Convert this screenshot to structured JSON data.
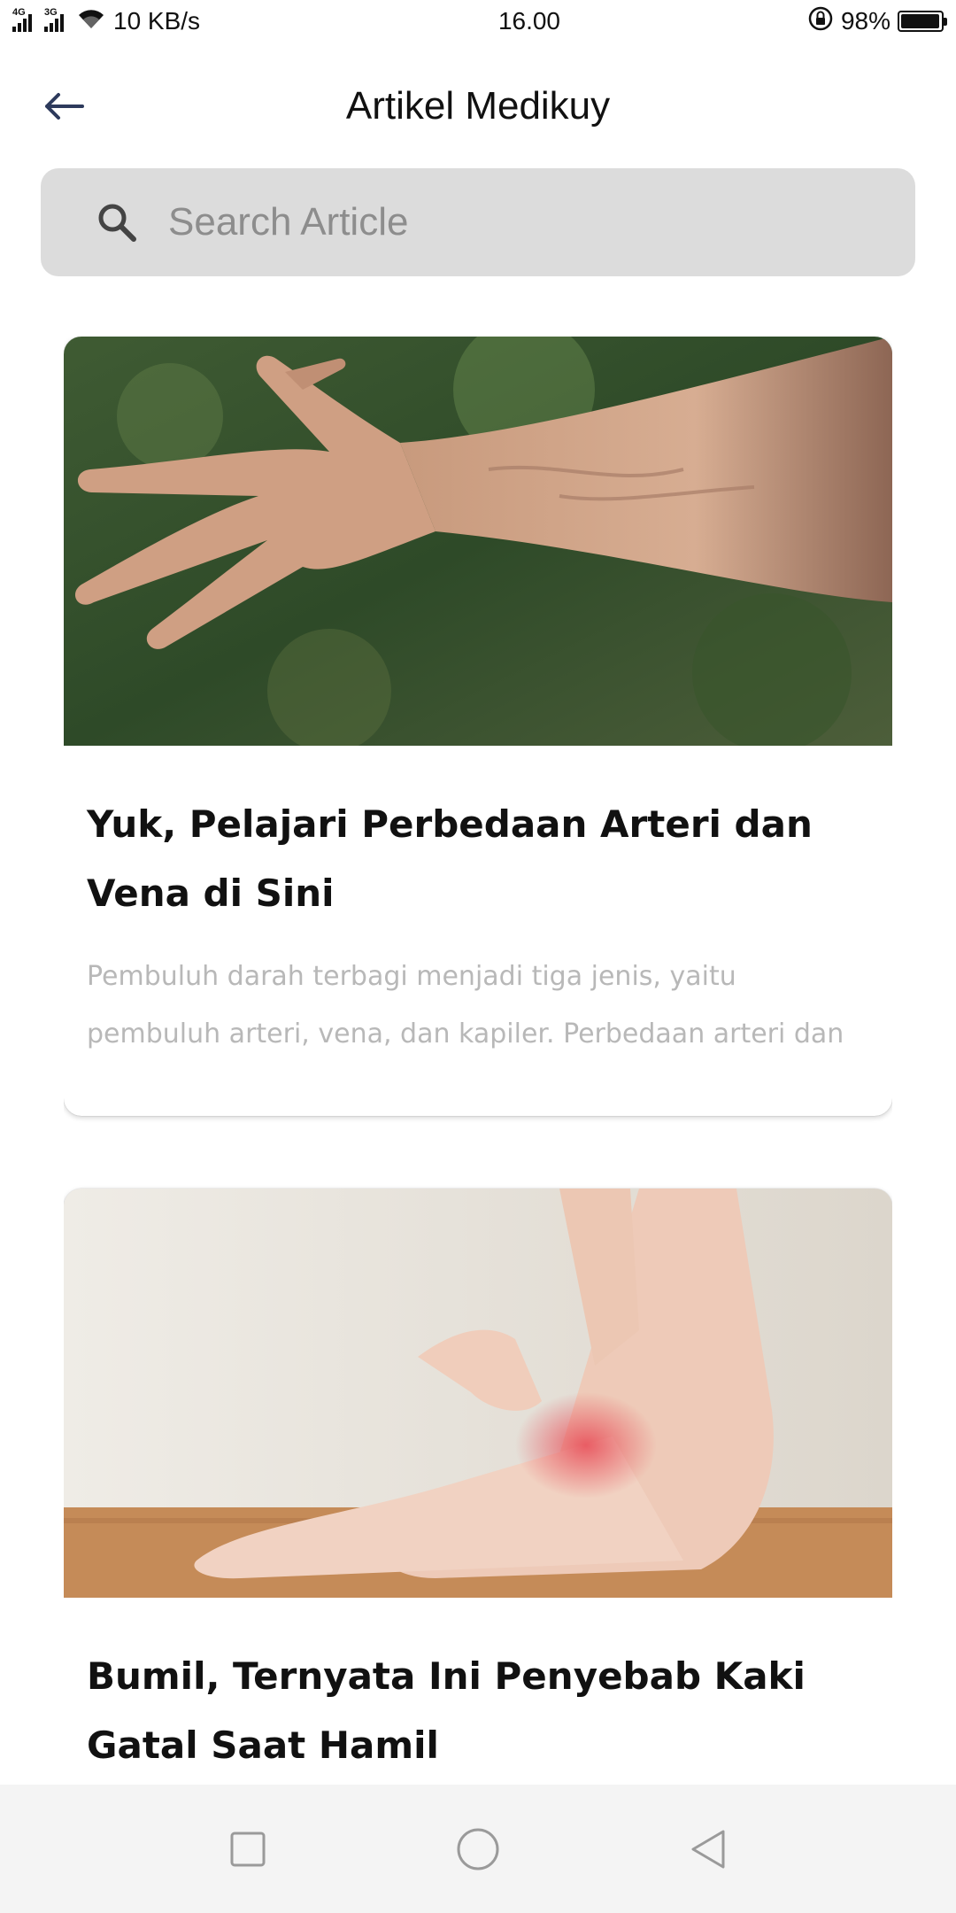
{
  "status_bar": {
    "net1": "4G",
    "net2": "3G",
    "speed": "10 KB/s",
    "time": "16.00",
    "battery_text": "98%",
    "battery_level": 0.98,
    "icons": [
      "signal-4g-icon",
      "signal-3g-icon",
      "wifi-icon",
      "rotation-lock-icon",
      "battery-icon"
    ]
  },
  "header": {
    "title": "Artikel Medikuy",
    "back_icon": "arrow-left-icon"
  },
  "search": {
    "placeholder": "Search Article",
    "value": "",
    "icon": "search-icon"
  },
  "articles": [
    {
      "title": "Yuk, Pelajari Perbedaan Arteri dan Vena di Sini",
      "excerpt_line1": "Pembuluh darah terbagi menjadi tiga jenis, yaitu",
      "excerpt_line2": "pembuluh arteri, vena, dan kapiler. Perbedaan arteri dan"
    },
    {
      "title": "Bumil, Ternyata Ini Penyebab Kaki Gatal Saat Hamil",
      "excerpt_line1": "",
      "excerpt_line2": ""
    }
  ],
  "nav_bar": {
    "icons": [
      "recents-square-icon",
      "home-circle-icon",
      "back-triangle-icon"
    ]
  },
  "colors": {
    "search_bg": "#dcdcdc",
    "back_arrow": "#2d3a5c",
    "excerpt": "#b8b8b8",
    "nav_bg": "#f4f4f4"
  }
}
